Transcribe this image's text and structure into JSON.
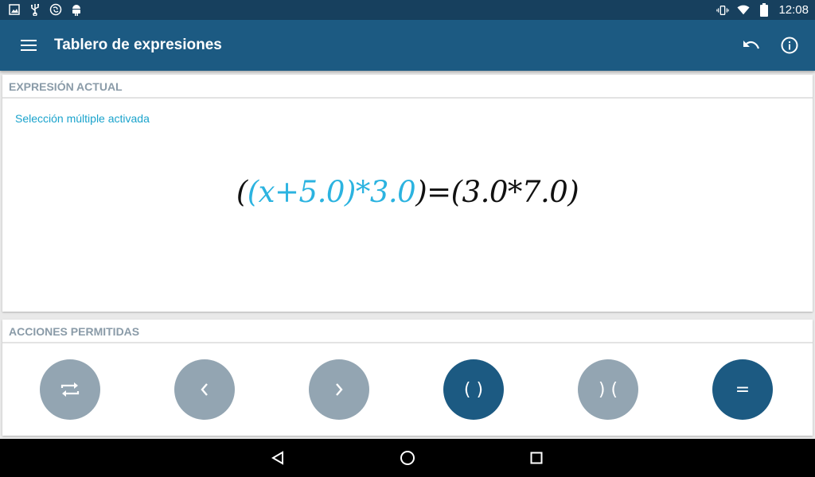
{
  "status_bar": {
    "time": "12:08",
    "left_icons": [
      "image-icon",
      "usb-icon",
      "sync-icon",
      "android-icon"
    ],
    "right_icons": [
      "vibrate-icon",
      "wifi-icon",
      "battery-icon"
    ]
  },
  "app_bar": {
    "title": "Tablero de expresiones",
    "menu_icon": "menu-icon",
    "actions": [
      "undo-icon",
      "info-icon"
    ]
  },
  "current_expression": {
    "header": "EXPRESIÓN ACTUAL",
    "note": "Selección múltiple activada",
    "expression_parts": [
      {
        "text": "(",
        "selected": false
      },
      {
        "text": "(x+5.0)*3.0",
        "selected": true
      },
      {
        "text": ")=(3.0*7.0)",
        "selected": false
      }
    ]
  },
  "allowed_actions": {
    "header": "ACCIONES PERMITIDAS",
    "buttons": [
      {
        "name": "swap",
        "icon": "swap-icon",
        "label": "",
        "enabled": false
      },
      {
        "name": "move-left",
        "icon": "chevron-left-icon",
        "label": "‹",
        "enabled": false
      },
      {
        "name": "move-right",
        "icon": "chevron-right-icon",
        "label": "›",
        "enabled": false
      },
      {
        "name": "add-parentheses",
        "icon": "",
        "label": "( )",
        "enabled": true
      },
      {
        "name": "remove-parentheses",
        "icon": "",
        "label": ") (",
        "enabled": false
      },
      {
        "name": "equals",
        "icon": "",
        "label": "=",
        "enabled": true
      }
    ]
  },
  "nav_bar": {
    "buttons": [
      "back-icon",
      "home-icon",
      "recents-icon"
    ]
  },
  "colors": {
    "status_bar": "#17405e",
    "app_bar": "#1c5a82",
    "selection": "#2bb3e0",
    "enabled_button": "#1c5a82",
    "disabled_button": "#93a5b2",
    "header_text": "#8a9ba8"
  }
}
